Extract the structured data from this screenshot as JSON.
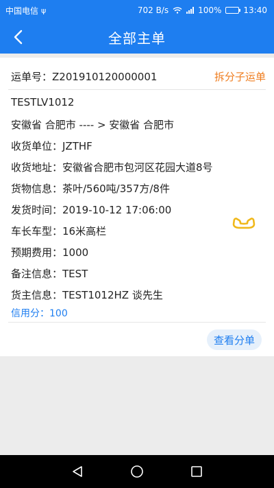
{
  "status_bar": {
    "carrier": "中国电信",
    "usb_icon": "usb-icon",
    "speed": "702 B/s",
    "battery": "100%",
    "time": "13:40"
  },
  "header": {
    "title": "全部主单",
    "back_icon": "back-arrow-icon"
  },
  "order": {
    "number_label": "运单号：Z201910120000001",
    "split_label": "拆分子运单",
    "code": "TESTLV1012",
    "route": "安徽省 合肥市  ---- >  安徽省 合肥市",
    "receiver_unit": "收货单位：JZTHF",
    "receiver_address": "收货地址：安徽省合肥市包河区花园大道8号",
    "goods_info": "货物信息：茶叶/560吨/357方/8件",
    "ship_time": "发货时间：2019-10-12 17:06:00",
    "vehicle": "车长车型：16米高栏",
    "expected_fee": "预期费用：1000",
    "remarks": "备注信息：TEST",
    "shipper": "货主信息：TEST1012HZ  谈先生",
    "credit": "信用分：100",
    "view_button": "查看分单",
    "phone_icon": "phone-icon",
    "accent_color": "#1e7ef0",
    "link_color": "#ef7d1f"
  },
  "nav": {
    "back": "nav-back-icon",
    "home": "nav-home-icon",
    "recent": "nav-recent-icon"
  }
}
